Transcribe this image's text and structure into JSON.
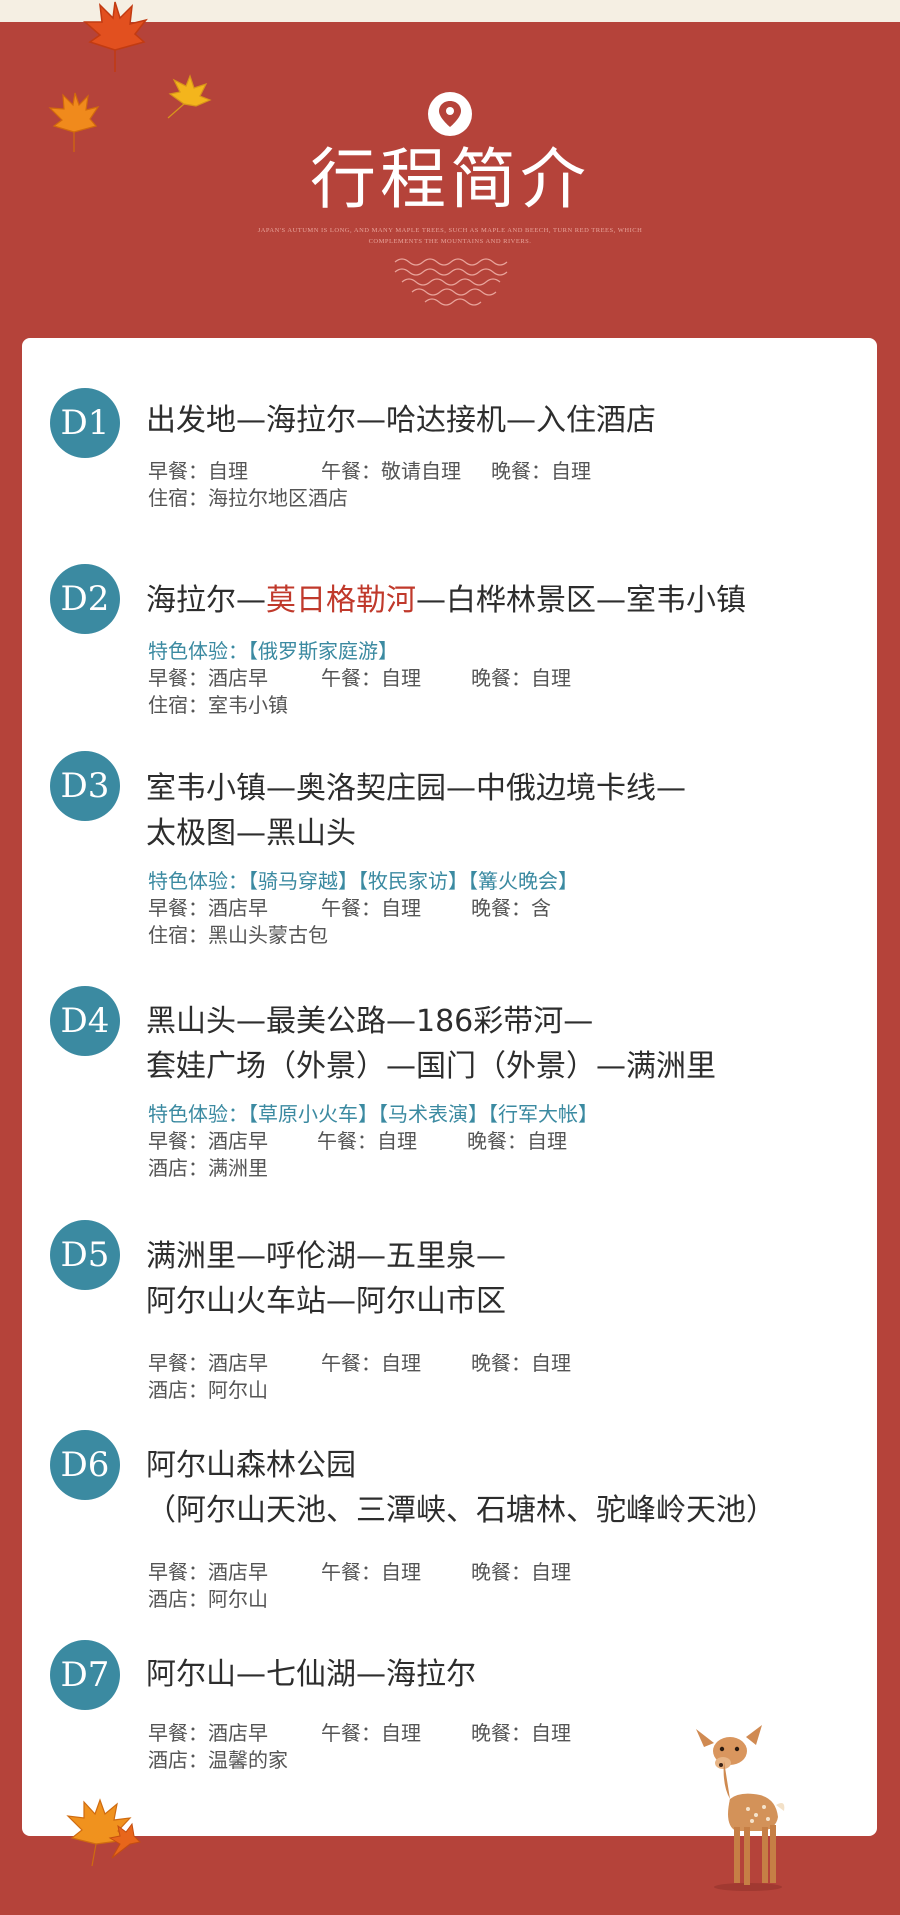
{
  "header": {
    "title": "行程简介",
    "subtitle": "JAPAN'S AUTUMN IS LONG, AND MANY MAPLE TREES, SUCH AS MAPLE AND BEECH, TURN RED TREES, WHICH COMPLEMENTS THE MOUNTAINS AND RIVERS."
  },
  "days": [
    {
      "badge": "D1",
      "route1": "出发地—海拉尔—哈达接机—入住酒店",
      "breakfast": "早餐：自理",
      "lunch": "午餐：敬请自理",
      "dinner": "晚餐：自理",
      "stay": "住宿：海拉尔地区酒店"
    },
    {
      "badge": "D2",
      "route_a": "海拉尔—",
      "route_hl": "莫日格勒河",
      "route_b": "—白桦林景区—室韦小镇",
      "feature_label": "特色体验：",
      "features": "【俄罗斯家庭游】",
      "breakfast": "早餐：酒店早",
      "lunch": "午餐：自理",
      "dinner": "晚餐：自理",
      "stay": "住宿：室韦小镇"
    },
    {
      "badge": "D3",
      "route1": "室韦小镇—奥洛契庄园—中俄边境卡线—",
      "route2": "太极图—黑山头",
      "feature_label": "特色体验：",
      "features": "【骑马穿越】【牧民家访】【篝火晚会】",
      "breakfast": "早餐：酒店早",
      "lunch": "午餐：自理",
      "dinner": "晚餐：含",
      "stay": "住宿：黑山头蒙古包"
    },
    {
      "badge": "D4",
      "route1": "黑山头—最美公路—186彩带河—",
      "route2": "套娃广场（外景）—国门（外景）—满洲里",
      "feature_label": "特色体验：",
      "features": "【草原小火车】【马术表演】【行军大帐】",
      "breakfast": "早餐：酒店早",
      "lunch": "午餐：自理",
      "dinner": "晚餐：自理",
      "stay": "酒店：满洲里"
    },
    {
      "badge": "D5",
      "route1": "满洲里—呼伦湖—五里泉—",
      "route2": "阿尔山火车站—阿尔山市区",
      "breakfast": "早餐：酒店早",
      "lunch": "午餐：自理",
      "dinner": "晚餐：自理",
      "stay": "酒店：阿尔山"
    },
    {
      "badge": "D6",
      "route1": "阿尔山森林公园",
      "route2": "（阿尔山天池、三潭峡、石塘林、驼峰岭天池）",
      "breakfast": "早餐：酒店早",
      "lunch": "午餐：自理",
      "dinner": "晚餐：自理",
      "stay": "酒店：阿尔山"
    },
    {
      "badge": "D7",
      "route1": "阿尔山—七仙湖—海拉尔",
      "breakfast": "早餐：酒店早",
      "lunch": "午餐：自理",
      "dinner": "晚餐：自理",
      "stay": "酒店：温馨的家"
    }
  ],
  "colors": {
    "background": "#b5433a",
    "badge": "#3b8aa1",
    "highlight": "#c0392b"
  },
  "icons": [
    "location-pin-icon",
    "maple-leaf-icon",
    "deer-illustration"
  ]
}
